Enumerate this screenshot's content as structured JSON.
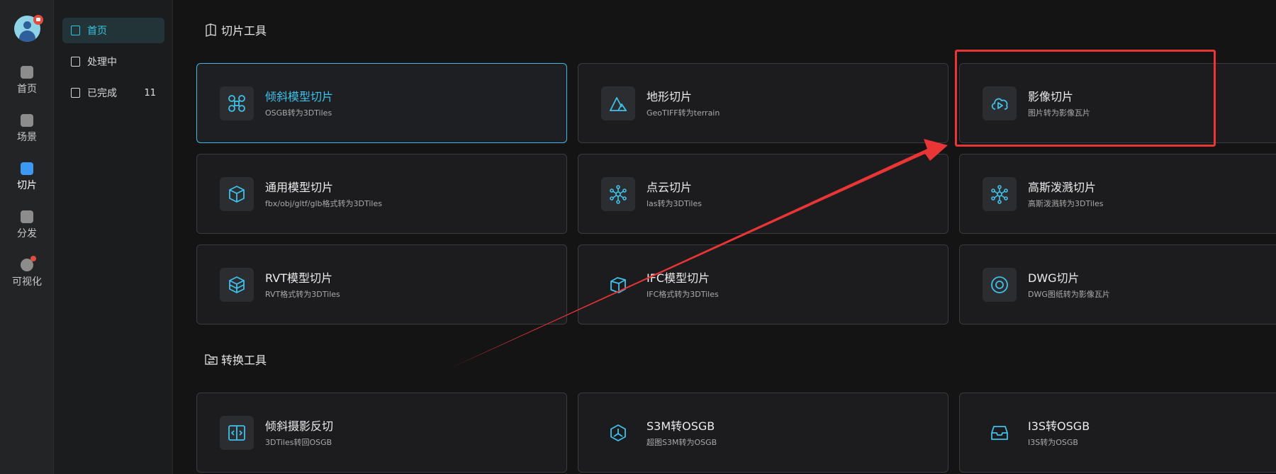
{
  "rail": {
    "items": [
      {
        "label": "首页",
        "icon": "home-icon"
      },
      {
        "label": "场景",
        "icon": "scene-icon"
      },
      {
        "label": "切片",
        "icon": "slice-icon"
      },
      {
        "label": "分发",
        "icon": "distribute-icon"
      },
      {
        "label": "可视化",
        "icon": "visualize-icon"
      }
    ],
    "active_index": 2
  },
  "menu": {
    "items": [
      {
        "label": "首页",
        "icon": "upload-doc-icon"
      },
      {
        "label": "处理中",
        "icon": "upload-doc-icon"
      },
      {
        "label": "已完成",
        "icon": "check-doc-icon",
        "count": "11"
      }
    ],
    "active_index": 0
  },
  "sections": {
    "slice_tools": {
      "title": "切片工具",
      "cards": [
        {
          "title": "倾斜模型切片",
          "subtitle": "OSGB转为3DTiles",
          "icon": "drone-icon"
        },
        {
          "title": "地形切片",
          "subtitle": "GeoTIFF转为terrain",
          "icon": "mountain-icon"
        },
        {
          "title": "影像切片",
          "subtitle": "图片转为影像瓦片",
          "icon": "cloud-play-icon"
        },
        {
          "title": "通用模型切片",
          "subtitle": "fbx/obj/gltf/glb格式转为3DTiles",
          "icon": "cube-icon"
        },
        {
          "title": "点云切片",
          "subtitle": "las转为3DTiles",
          "icon": "point-cloud-icon"
        },
        {
          "title": "高斯泼溅切片",
          "subtitle": "高斯泼溅转为3DTiles",
          "icon": "gaussian-icon"
        },
        {
          "title": "RVT模型切片",
          "subtitle": "RVT格式转为3DTiles",
          "icon": "layers-cube-icon"
        },
        {
          "title": "IFC模型切片",
          "subtitle": "IFC格式转为3DTiles",
          "icon": "box-icon"
        },
        {
          "title": "DWG切片",
          "subtitle": "DWG图纸转为影像瓦片",
          "icon": "circle-icon"
        }
      ]
    },
    "convert_tools": {
      "title": "转换工具",
      "cards": [
        {
          "title": "倾斜摄影反切",
          "subtitle": "3DTiles转回OSGB",
          "icon": "reverse-icon"
        },
        {
          "title": "S3M转OSGB",
          "subtitle": "超图S3M转为OSGB",
          "icon": "tri-hex-icon"
        },
        {
          "title": "I3S转OSGB",
          "subtitle": "I3S转为OSGB",
          "icon": "tray-icon"
        }
      ]
    }
  },
  "colors": {
    "accent": "#3fc1ea",
    "annotation": "#e83535",
    "rail_bg": "#232426",
    "page_bg": "#141414"
  }
}
